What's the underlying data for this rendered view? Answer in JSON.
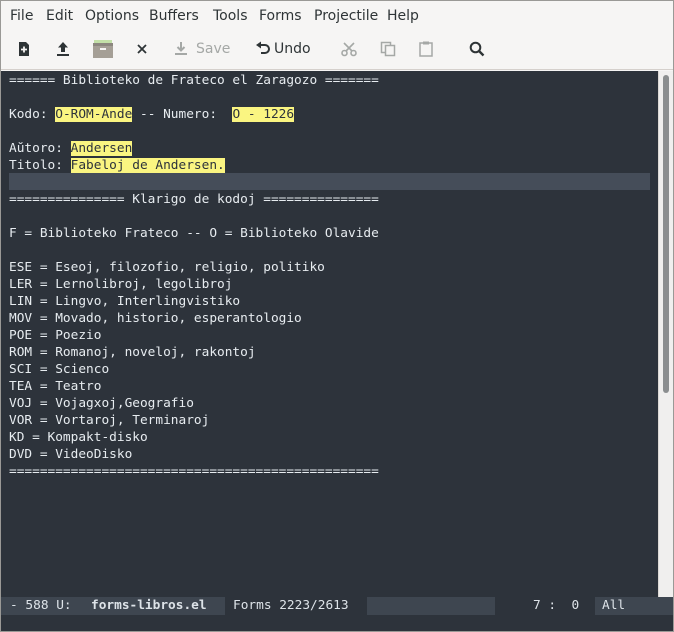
{
  "menu": [
    "File",
    "Edit",
    "Options",
    "Buffers",
    "Tools",
    "Forms",
    "Projectile",
    "Help"
  ],
  "toolbar": {
    "save_label": "Save",
    "undo_label": "Undo"
  },
  "editor": {
    "header": "====== Biblioteko de Frateco el Zaragozo =======",
    "kodo_label": "Kodo: ",
    "kodo_value": "O-ROM-Ande",
    "numero_label": " -- Numero: ",
    "numero_value": "O - 1226",
    "autoro_label": "Aŭtoro: ",
    "autoro_value": "Andersen",
    "titolo_label": "Titolo: ",
    "titolo_value": "Fabeloj de Andersen.",
    "klarigo_header": "=============== Klarigo de kodoj ===============",
    "legend_fo": "F = Biblioteko Frateco -- O = Biblioteko Olavide",
    "codes": [
      "ESE = Eseoj, filozofio, religio, politiko",
      "LER = Lernolibroj, legolibroj",
      "LIN = Lingvo, Interlingvistiko",
      "MOV = Movado, historio, esperantologio",
      "POE = Poezio",
      "ROM = Romanoj, noveloj, rakontoj",
      "SCI = Scienco",
      "TEA = Teatro",
      "VOJ = Vojagxoj,Geografio",
      "VOR = Vortaroj, Terminaroj",
      "KD = Kompakt-disko",
      "DVD = VideoDisko"
    ],
    "footer": "================================================"
  },
  "modeline": {
    "status": "- 588 U:",
    "buffer_name": "forms-libros.el",
    "mode": "Forms 2223/2613",
    "position": "7 :  0",
    "scroll": "All"
  }
}
